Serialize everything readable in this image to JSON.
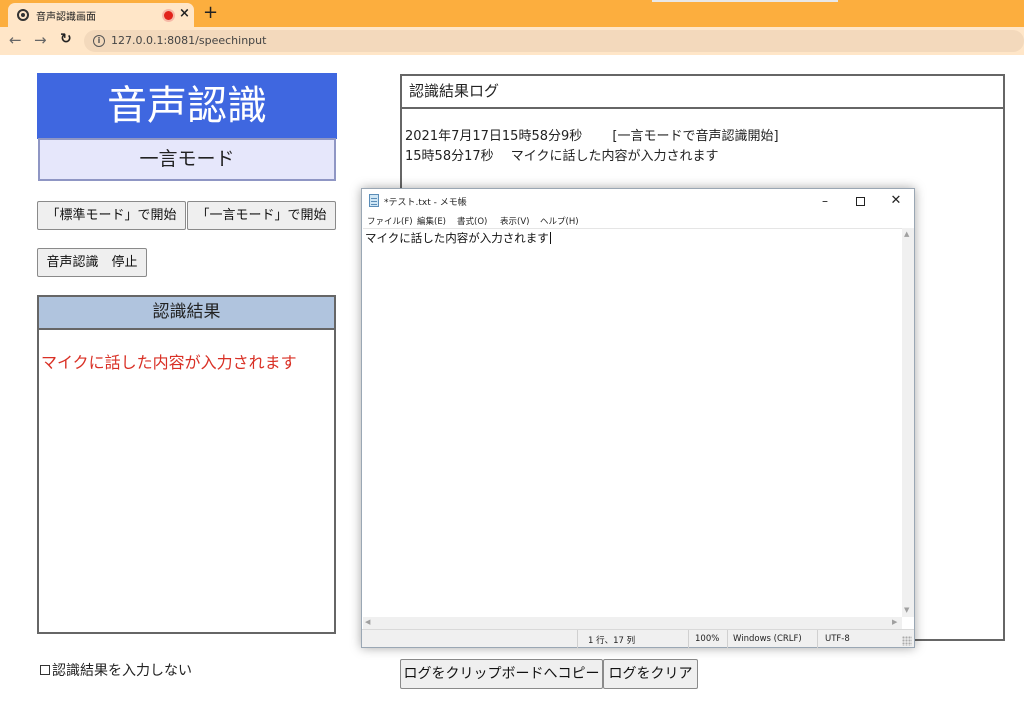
{
  "browser": {
    "tab_title": "音声認識画面",
    "tab_close": "×",
    "new_tab": "+",
    "url": "127.0.0.1:8081/speechinput"
  },
  "page": {
    "app_title": "音声認識",
    "mode_label": "一言モード",
    "buttons": {
      "start_standard": "「標準モード」で開始",
      "start_one_word": "「一言モード」で開始",
      "stop": "音声認識　停止",
      "copy_log": "ログをクリップボードへコピー",
      "clear_log": "ログをクリア"
    },
    "result": {
      "header": "認識結果",
      "text": "マイクに話した内容が入力されます"
    },
    "no_input_checkbox": "認識結果を入力しない",
    "log": {
      "header": "認識結果ログ",
      "lines": [
        "2021年7月17日15時58分9秒　　 [一言モードで音声認識開始]",
        "15時58分17秒　 マイクに話した内容が入力されます"
      ]
    }
  },
  "notepad": {
    "title": "*テスト.txt - メモ帳",
    "controls": {
      "minimize": "–",
      "close": "✕"
    },
    "menu": [
      "ファイル(F)",
      "編集(E)",
      "書式(O)",
      "表示(V)",
      "ヘルプ(H)"
    ],
    "content": "マイクに話した内容が入力されます",
    "status": {
      "position": "1 行、17 列",
      "zoom": "100%",
      "line_ending": "Windows (CRLF)",
      "encoding": "UTF-8"
    }
  }
}
